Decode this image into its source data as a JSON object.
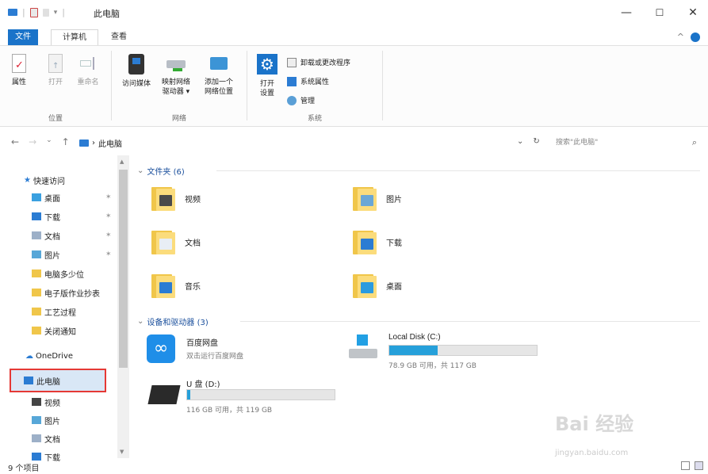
{
  "titlebar": {
    "title": "此电脑",
    "minimize": "—",
    "maximize": "☐",
    "close": "✕"
  },
  "ribbon_tabs": {
    "file": "文件",
    "computer": "计算机",
    "view": "查看",
    "collapse": "^"
  },
  "ribbon": {
    "location": {
      "label": "位置",
      "properties": "属性",
      "open": "打开",
      "rename": "重命名"
    },
    "network": {
      "label": "网络",
      "access_media": "访问媒体",
      "map_drive_line1": "映射网络",
      "map_drive_line2": "驱动器 ▾",
      "add_location_line1": "添加一个",
      "add_location_line2": "网络位置"
    },
    "system": {
      "label": "系统",
      "open_settings_line1": "打开",
      "open_settings_line2": "设置",
      "uninstall": "卸载或更改程序",
      "system_props": "系统属性",
      "manage": "管理"
    }
  },
  "address": {
    "back": "←",
    "forward": "→",
    "down": "⌄",
    "up": "↑",
    "path_sep": "›",
    "path": "此电脑",
    "dropdown": "⌄",
    "refresh": "↻",
    "search_placeholder": "搜索\"此电脑\"",
    "search_icon": "⌕"
  },
  "nav": {
    "quick_access": "快速访问",
    "items_quick": [
      {
        "label": "桌面",
        "pinned": true,
        "color": "#3aa0e0"
      },
      {
        "label": "下载",
        "pinned": true,
        "color": "#2b7cd3"
      },
      {
        "label": "文档",
        "pinned": true,
        "color": "#9db0c8"
      },
      {
        "label": "图片",
        "pinned": true,
        "color": "#57a7d8"
      },
      {
        "label": "电脑多少位",
        "pinned": false,
        "color": "#f0c64a"
      },
      {
        "label": "电子版作业抄表",
        "pinned": false,
        "color": "#f0c64a"
      },
      {
        "label": "工艺过程",
        "pinned": false,
        "color": "#f0c64a"
      },
      {
        "label": "关闭通知",
        "pinned": false,
        "color": "#f0c64a"
      }
    ],
    "pin_glyph": "✶",
    "onedrive": "OneDrive",
    "this_pc": "此电脑",
    "items_pc": [
      {
        "label": "视频",
        "color": "#444444"
      },
      {
        "label": "图片",
        "color": "#57a7d8"
      },
      {
        "label": "文档",
        "color": "#9db0c8"
      },
      {
        "label": "下载",
        "color": "#2b7cd3"
      }
    ],
    "scroll_up": "▲",
    "scroll_down": "▼"
  },
  "content": {
    "folders_header": "文件夹 (6)",
    "folders": [
      {
        "label": "视频",
        "badge": "#4a4a4a"
      },
      {
        "label": "图片",
        "badge": "#6aa7d6"
      },
      {
        "label": "文档",
        "badge": "#e8eef5"
      },
      {
        "label": "下载",
        "badge": "#2b7cd3"
      },
      {
        "label": "音乐",
        "badge": "#2b7cd3"
      },
      {
        "label": "桌面",
        "badge": "#2b9be0"
      }
    ],
    "devices_header": "设备和驱动器 (3)",
    "devices": [
      {
        "name": "百度网盘",
        "sub": "双击运行百度网盘"
      },
      {
        "name": "Local Disk (C:)",
        "info": "78.9 GB 可用，共 117 GB",
        "fill_fraction": 0.33
      },
      {
        "name": "U 盘 (D:)",
        "info": "116 GB 可用，共 119 GB",
        "fill_fraction": 0.02
      }
    ],
    "chevron": "⌄"
  },
  "watermark": {
    "main": "Bai 经验",
    "sub": "jingyan.baidu.com"
  },
  "status": {
    "count": "9 个项目"
  }
}
